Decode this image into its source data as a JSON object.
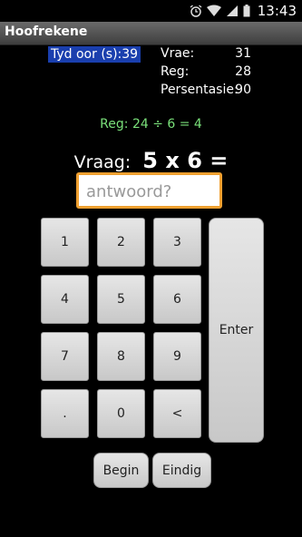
{
  "status": {
    "time": "13:43"
  },
  "app": {
    "title": "Hoofrekene"
  },
  "timer": {
    "text": "Tyd oor (s):39"
  },
  "stats": [
    {
      "label": "Vrae:",
      "value": "31"
    },
    {
      "label": "Reg:",
      "value": "28"
    },
    {
      "label": "Persentasie:",
      "value": "90"
    }
  ],
  "feedback": "Reg: 24 ÷ 6 = 4",
  "question": {
    "label": "Vraag:",
    "expression": "5 x 6 ="
  },
  "answer": {
    "placeholder": "antwoord?"
  },
  "keypad": {
    "keys": [
      "1",
      "2",
      "3",
      "4",
      "5",
      "6",
      "7",
      "8",
      "9",
      ".",
      "0",
      "<"
    ],
    "enter": "Enter"
  },
  "buttons": {
    "begin": "Begin",
    "end": "Eindig"
  }
}
